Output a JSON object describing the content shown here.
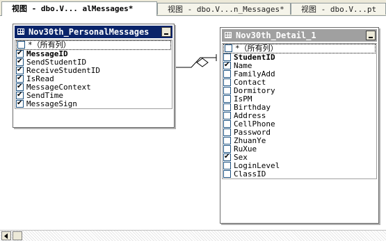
{
  "tabs": [
    {
      "label": "视图 - dbo.V... alMessages*",
      "active": true
    },
    {
      "label": "视图 - dbo.V...n_Messages*",
      "active": false
    },
    {
      "label": "视图 - dbo.V...pt",
      "active": false
    }
  ],
  "table_left": {
    "title": "Nov30th_PersonalMessages",
    "columns": [
      {
        "label": "*（所有列）",
        "checked": false,
        "primary_key": false
      },
      {
        "label": "MessageID",
        "checked": true,
        "primary_key": true
      },
      {
        "label": "SendStudentID",
        "checked": true,
        "primary_key": false
      },
      {
        "label": "ReceiveStudentID",
        "checked": true,
        "primary_key": false
      },
      {
        "label": "IsRead",
        "checked": true,
        "primary_key": false
      },
      {
        "label": "MessageContext",
        "checked": true,
        "primary_key": false
      },
      {
        "label": "SendTime",
        "checked": true,
        "primary_key": false
      },
      {
        "label": "MessageSign",
        "checked": true,
        "primary_key": false
      }
    ]
  },
  "table_right": {
    "title": "Nov30th_Detail_1",
    "columns": [
      {
        "label": "*（所有列）",
        "checked": false,
        "primary_key": false
      },
      {
        "label": "StudentID",
        "checked": false,
        "primary_key": true
      },
      {
        "label": "Name",
        "checked": true,
        "primary_key": false
      },
      {
        "label": "FamilyAdd",
        "checked": false,
        "primary_key": false
      },
      {
        "label": "Contact",
        "checked": false,
        "primary_key": false
      },
      {
        "label": "Dormitory",
        "checked": false,
        "primary_key": false
      },
      {
        "label": "IsPM",
        "checked": false,
        "primary_key": false
      },
      {
        "label": "Birthday",
        "checked": false,
        "primary_key": false
      },
      {
        "label": "Address",
        "checked": false,
        "primary_key": false
      },
      {
        "label": "CellPhone",
        "checked": false,
        "primary_key": false
      },
      {
        "label": "Password",
        "checked": false,
        "primary_key": false
      },
      {
        "label": "ZhuanYe",
        "checked": false,
        "primary_key": false
      },
      {
        "label": "RuXue",
        "checked": false,
        "primary_key": false
      },
      {
        "label": "Sex",
        "checked": true,
        "primary_key": false
      },
      {
        "label": "LoginLevel",
        "checked": false,
        "primary_key": false
      },
      {
        "label": "ClassID",
        "checked": false,
        "primary_key": false
      }
    ]
  },
  "colors": {
    "active_title": "#0a246a",
    "inactive_title": "#a0a0a0"
  }
}
